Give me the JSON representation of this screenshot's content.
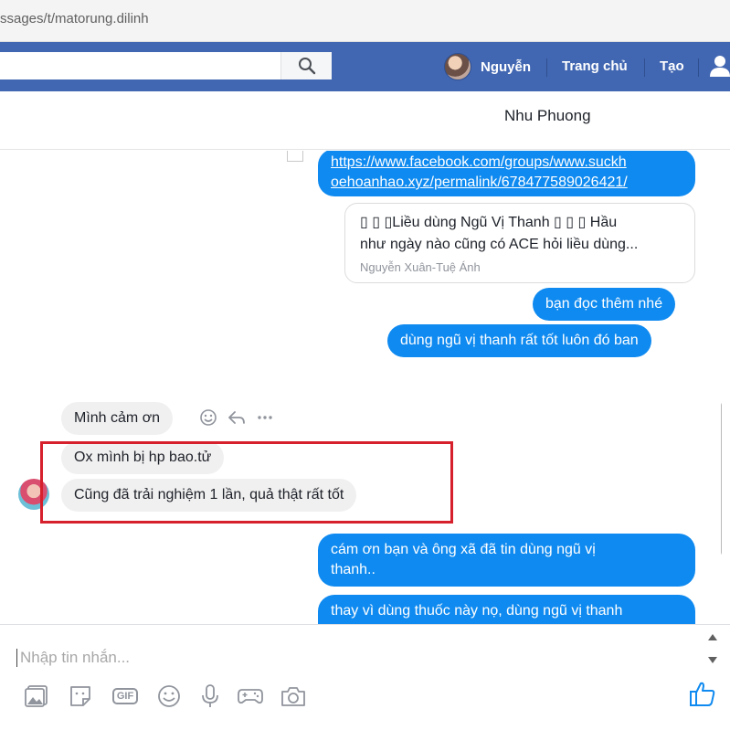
{
  "browser": {
    "url": "ssages/t/matorung.dilinh"
  },
  "nav": {
    "user_name": "Nguyễn",
    "home": "Trang chủ",
    "create": "Tạo"
  },
  "chat": {
    "title": "Nhu Phuong"
  },
  "messages": {
    "link_line1": "https://www.facebook.com/groups/www.suckh",
    "link_line2": "oehoanhao.xyz/permalink/678477589026421/",
    "preview_line1": "▯ ▯ ▯Liều dùng Ngũ Vị Thanh ▯ ▯ ▯ Hầu",
    "preview_line2": "như ngày nào cũng có ACE hỏi liều dùng...",
    "preview_author": "Nguyễn Xuân-Tuệ Ánh",
    "out_1": "bạn đọc thêm nhé",
    "out_2": "dùng ngũ vị thanh rất tốt luôn đó ban",
    "in_1": "Mình cảm ơn",
    "in_2": "Ox mình bị hp bao.tử",
    "in_3": "Cũng đã trải nghiệm 1 lần, quả thật rất tốt",
    "out_3_line1": "cám ơn bạn và ông xã đã tin dùng ngũ vị",
    "out_3_line2": "thanh..",
    "out_4": "thay vì dùng thuốc này nọ, dùng ngũ vị thanh"
  },
  "composer": {
    "placeholder": "Nhập tin nhắn..."
  },
  "icons": {
    "search": "search-icon",
    "reaction": "smiley-icon",
    "reply": "reply-icon",
    "more": "more-icon",
    "photo": "photo-icon",
    "sticker": "sticker-icon",
    "gif": "GIF",
    "emoji": "emoji-icon",
    "mic": "microphone-icon",
    "game": "game-icon",
    "camera": "camera-icon",
    "like": "thumbs-up-icon"
  },
  "colors": {
    "fb_blue": "#4267b2",
    "bubble_out": "#0f8af0",
    "bubble_in": "#f1f0f0",
    "highlight": "#d6202c"
  }
}
